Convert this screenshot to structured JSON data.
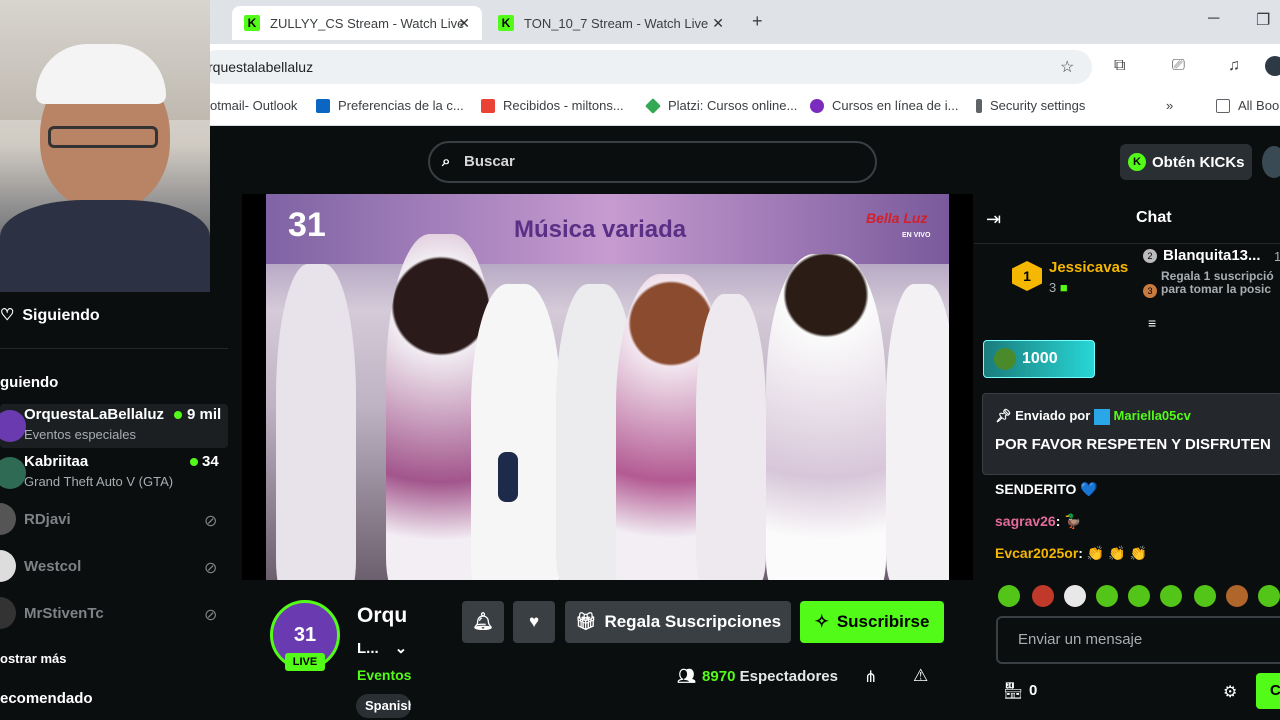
{
  "browser": {
    "tabs": [
      {
        "title": "ZULLYY_CS Stream - Watch Live"
      },
      {
        "title": "TON_10_7 Stream - Watch Live"
      }
    ],
    "url": "rquestalabellaluz",
    "bookmarks": [
      {
        "label": "otmail- Outlook"
      },
      {
        "label": "Preferencias de la c..."
      },
      {
        "label": "Recibidos - miltons..."
      },
      {
        "label": "Platzi: Cursos online..."
      },
      {
        "label": "Cursos en línea de i..."
      },
      {
        "label": "Security settings"
      },
      {
        "label": "All Boo"
      }
    ]
  },
  "header": {
    "search_placeholder": "Buscar",
    "get_kicks_label": "Obtén KICKs"
  },
  "sidebar": {
    "following_title": "Siguiendo",
    "section_label": "guiendo",
    "channels": [
      {
        "name": "OrquestaLaBellaluz",
        "category": "Eventos especiales",
        "viewers": "9 mil",
        "live": true
      },
      {
        "name": "Kabriitaa",
        "category": "Grand Theft Auto V (GTA)",
        "viewers": "34",
        "live": true
      },
      {
        "name": "RDjavi",
        "category": "",
        "viewers": "",
        "live": false
      },
      {
        "name": "Westcol",
        "category": "",
        "viewers": "",
        "live": false
      },
      {
        "name": "MrStivenTc",
        "category": "",
        "viewers": "",
        "live": false
      }
    ],
    "show_more": "ostrar más",
    "recommended": "ecomendado"
  },
  "video": {
    "overlay_title": "Música variada",
    "badge": "31",
    "brand": "Bella Luz",
    "brand_sub": "EN VIVO"
  },
  "stream": {
    "channel_short": "Orqu",
    "title_short": "L...",
    "category_short": "Eventos",
    "tag": "Spanish",
    "live_badge": "LIVE",
    "avatar_text": "31",
    "gift_label": "Regala Suscripciones",
    "subscribe_label": "Suscribirse",
    "viewers_count": "8970",
    "viewers_label": "Espectadores"
  },
  "chat": {
    "title": "Chat",
    "leaderboard": [
      {
        "rank": "1",
        "name": "Jessicavas",
        "count": "3"
      },
      {
        "rank": "2",
        "name": "Blanquita13...",
        "count": "1"
      },
      {
        "rank": "3",
        "name": "Regala 1 suscripció para tomar la posic",
        "count": "3"
      }
    ],
    "kicks_amount": "1000",
    "pinned_by_label": "Enviado por",
    "pinned_by_user": "Mariella05cv",
    "pinned_message": "POR FAVOR RESPETEN Y DISFRUTEN",
    "messages": [
      {
        "user": "",
        "text": "SENDERITO 💙"
      },
      {
        "user": "sagrav26",
        "text": ": 🦆"
      },
      {
        "user": "Evcar2025or",
        "text": ": 👏 👏 👏"
      }
    ],
    "input_placeholder": "Enviar un mensaje",
    "points": "0",
    "send_label": "C"
  },
  "colors": {
    "kick_green": "#53fc18",
    "bg": "#0b0e0f",
    "panel": "#24272c"
  }
}
